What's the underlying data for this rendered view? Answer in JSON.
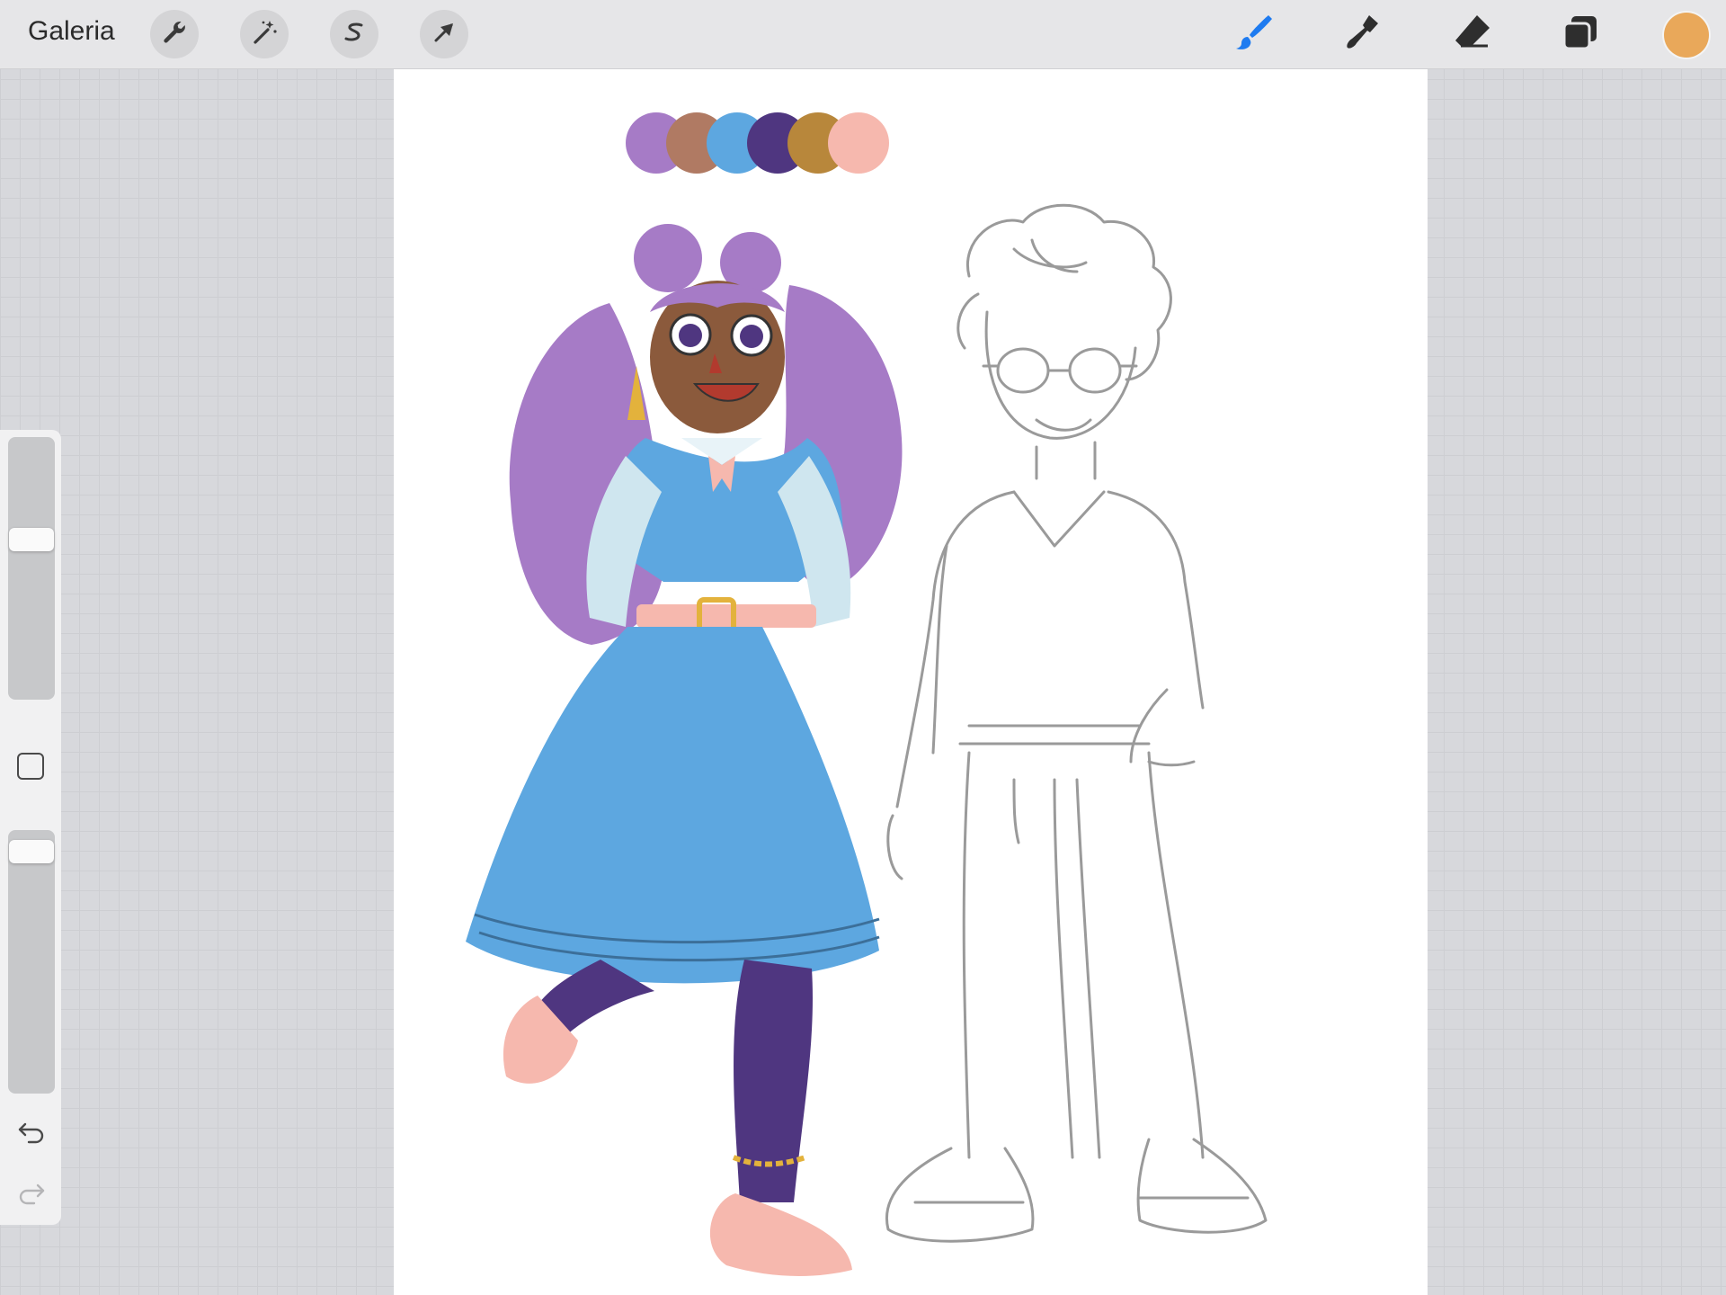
{
  "topbar": {
    "gallery_label": "Galeria",
    "left_tools": [
      {
        "name": "actions",
        "icon": "wrench-icon"
      },
      {
        "name": "adjustments",
        "icon": "magic-wand-icon"
      },
      {
        "name": "selection",
        "icon": "selection-s-icon"
      },
      {
        "name": "transform",
        "icon": "arrow-cursor-icon"
      }
    ],
    "right_tools": [
      {
        "name": "brush",
        "icon": "brush-icon",
        "active": true
      },
      {
        "name": "smudge",
        "icon": "smudge-finger-icon"
      },
      {
        "name": "eraser",
        "icon": "eraser-icon"
      },
      {
        "name": "layers",
        "icon": "layers-icon"
      }
    ],
    "current_color": "#E9A85A",
    "active_tool_color": "#1E7BF0"
  },
  "sidebar": {
    "brush_size_level": 0.62,
    "opacity_level": 0.96,
    "buttons": [
      "modify-square-icon",
      "undo-icon",
      "redo-icon"
    ]
  },
  "canvas": {
    "palette_swatches": [
      "#A67BC6",
      "#B07A63",
      "#5DA7E0",
      "#4F3680",
      "#B8873B",
      "#F6B8AE"
    ]
  }
}
